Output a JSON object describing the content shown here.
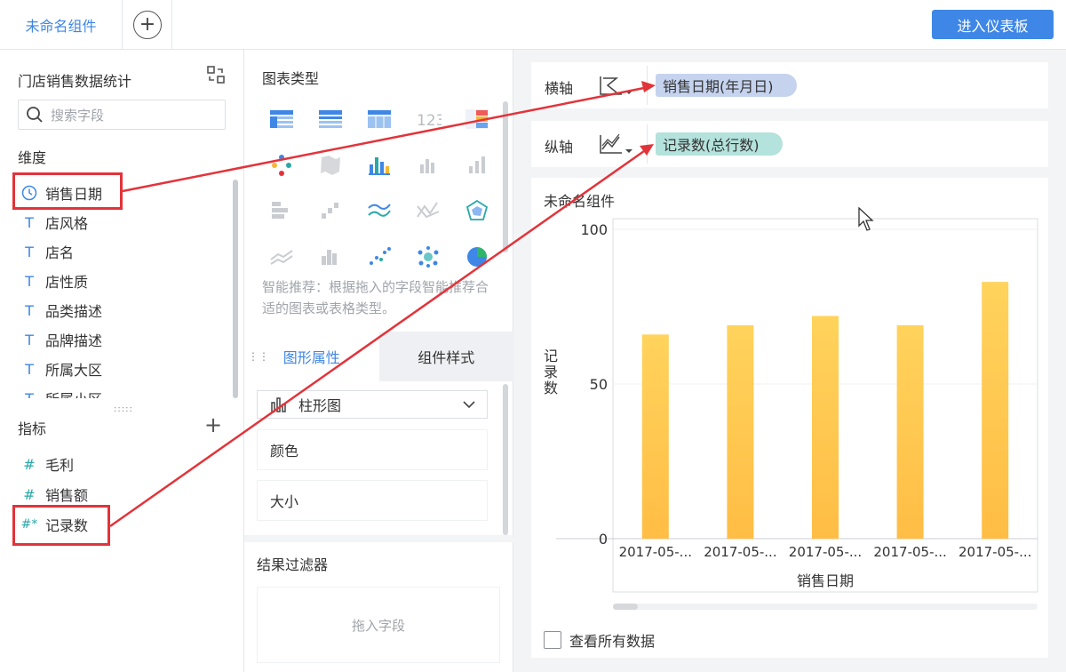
{
  "topbar": {
    "component_tab": "未命名组件",
    "add_tab_symbol": "+",
    "dashboard_button": "进入仪表板"
  },
  "left_panel": {
    "dataset_title": "门店销售数据统计",
    "search_placeholder": "搜索字段",
    "dimensions_label": "维度",
    "dimensions": [
      {
        "icon": "clock-icon",
        "label": "销售日期"
      },
      {
        "icon": "text-t-icon",
        "label": "店风格"
      },
      {
        "icon": "text-t-icon",
        "label": "店名"
      },
      {
        "icon": "text-t-icon",
        "label": "店性质"
      },
      {
        "icon": "text-t-icon",
        "label": "品类描述"
      },
      {
        "icon": "text-t-icon",
        "label": "品牌描述"
      },
      {
        "icon": "text-t-icon",
        "label": "所属大区"
      },
      {
        "icon": "text-t-icon",
        "label": "所属小区"
      }
    ],
    "metrics_label": "指标",
    "metrics": [
      {
        "icon": "hash-icon",
        "symbol": "#",
        "label": "毛利"
      },
      {
        "icon": "hash-icon",
        "symbol": "#",
        "label": "销售额"
      },
      {
        "icon": "hash-star-icon",
        "symbol": "#*",
        "label": "记录数"
      }
    ]
  },
  "middle_panel": {
    "chart_types_label": "图表类型",
    "smart_hint": "智能推荐：根据拖入的字段智能推荐合适的图表或表格类型。",
    "tabs": [
      "图形属性",
      "组件样式"
    ],
    "chart_type_selected": "柱形图",
    "properties": [
      "颜色",
      "大小"
    ],
    "filter_title": "结果过滤器",
    "filter_placeholder": "拖入字段"
  },
  "right_panel": {
    "x_axis_label": "横轴",
    "x_axis_field": "销售日期(年月日)",
    "y_axis_label": "纵轴",
    "y_axis_field": "记录数(总行数)",
    "chart_title": "未命名组件",
    "show_all_data": "查看所有数据"
  },
  "colors": {
    "accent": "#3f87e6",
    "bar_top": "#ffd35c",
    "bar_bottom": "#ffbd45",
    "highlight": "#e3333a"
  },
  "chart_data": {
    "type": "bar",
    "categories": [
      "2017-05-...",
      "2017-05-...",
      "2017-05-...",
      "2017-05-...",
      "2017-05-..."
    ],
    "values": [
      66,
      69,
      72,
      69,
      83
    ],
    "xlabel": "销售日期",
    "ylabel": "记录数",
    "ylim": [
      0,
      100
    ],
    "yticks": [
      "0",
      "50",
      "100"
    ],
    "grid": true
  }
}
